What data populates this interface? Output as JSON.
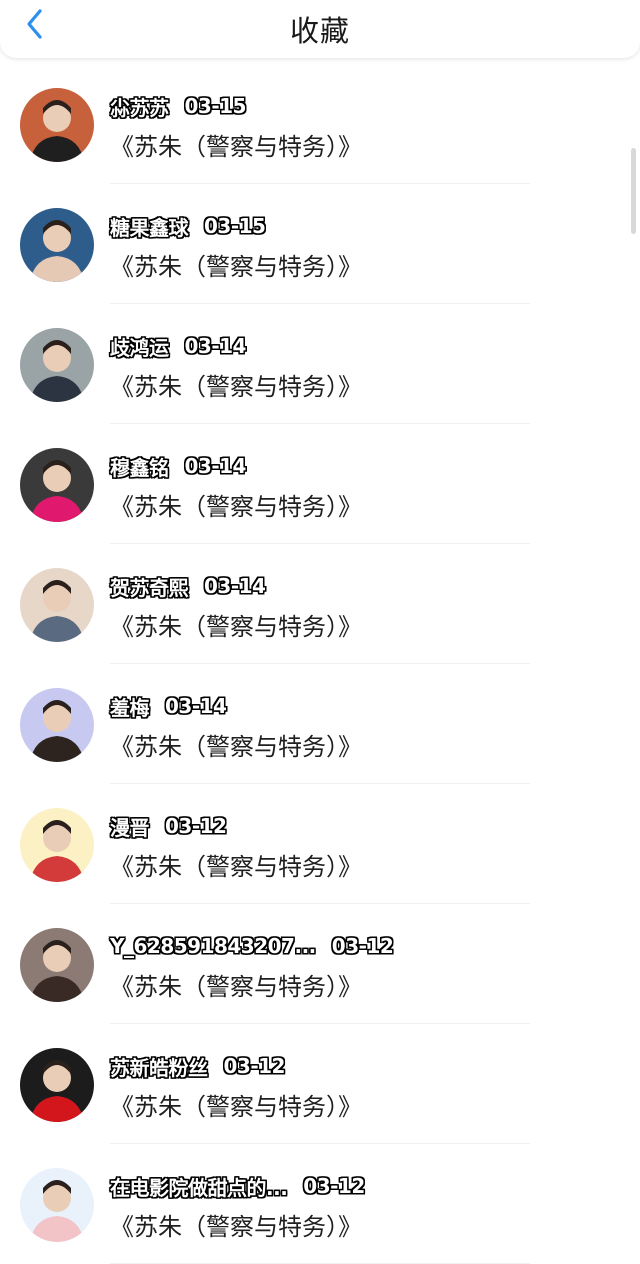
{
  "header": {
    "title": "收藏",
    "back_icon": "chevron-left-icon",
    "accent": "#2b8ff0"
  },
  "items": [
    {
      "name": "尛苏苏",
      "date": "03-15",
      "work": "《苏朱（警察与特务）》",
      "avatar_colors": [
        "#c7613b",
        "#1f1f1f"
      ]
    },
    {
      "name": "糖果鑫球",
      "date": "03-15",
      "work": "《苏朱（警察与特务）》",
      "avatar_colors": [
        "#2e5d8c",
        "#e6c9b5"
      ]
    },
    {
      "name": "歧鸿运",
      "date": "03-14",
      "work": "《苏朱（警察与特务）》",
      "avatar_colors": [
        "#9aa3a6",
        "#2b3440"
      ]
    },
    {
      "name": "穆鑫铭",
      "date": "03-14",
      "work": "《苏朱（警察与特务）》",
      "avatar_colors": [
        "#3a3a3a",
        "#e0196e"
      ]
    },
    {
      "name": "贺苏奇熙",
      "date": "03-14",
      "work": "《苏朱（警察与特务）》",
      "avatar_colors": [
        "#e7d7c8",
        "#5a6a80"
      ]
    },
    {
      "name": "羞梅",
      "date": "03-14",
      "work": "《苏朱（警察与特务）》",
      "avatar_colors": [
        "#c8c9f0",
        "#2d2420"
      ]
    },
    {
      "name": "漫晋",
      "date": "03-12",
      "work": "《苏朱（警察与特务）》",
      "avatar_colors": [
        "#fbf1c4",
        "#d33a3a"
      ]
    },
    {
      "name": "Y_628591843207...",
      "date": "03-12",
      "work": "《苏朱（警察与特务）》",
      "avatar_colors": [
        "#8b7b74",
        "#3a2a26"
      ]
    },
    {
      "name": "苏新皓粉丝",
      "date": "03-12",
      "work": "《苏朱（警察与特务）》",
      "avatar_colors": [
        "#1c1c1c",
        "#d3161c"
      ]
    },
    {
      "name": "在电影院做甜点的...",
      "date": "03-12",
      "work": "《苏朱（警察与特务）》",
      "avatar_colors": [
        "#e9f1fb",
        "#f2c3c7"
      ]
    }
  ]
}
